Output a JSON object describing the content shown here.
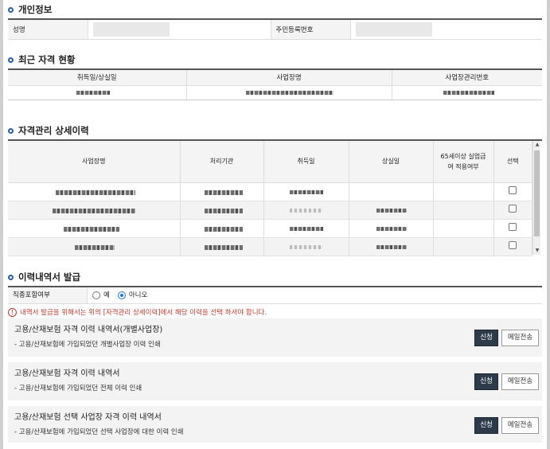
{
  "personal": {
    "title": "개인정보",
    "name_label": "성명",
    "rrn_label": "주민등록번호"
  },
  "current": {
    "title": "최근 자격 현황",
    "headers": [
      "취득일/상실일",
      "사업장명",
      "사업장관리번호"
    ]
  },
  "detail": {
    "title": "자격관리 상세이력",
    "headers": [
      "사업장명",
      "처리기관",
      "취득일",
      "상실일",
      "65세이상 실업급여 적용여부",
      "선택"
    ],
    "rows": [
      {
        "selected": false
      },
      {
        "selected": false
      },
      {
        "selected": false
      },
      {
        "selected": false
      }
    ]
  },
  "issue": {
    "title": "이력내역서 발급",
    "include_label": "직종포함여부",
    "option_yes": "예",
    "option_no": "아니오",
    "selected_option": "아니오",
    "notice": "내역서 발급을 위해서는 위의 [자격관리 상세이력]에서 해당 이력을 선택 하셔야 합니다.",
    "notice_icon": "exclamation-circle-icon",
    "docs": [
      {
        "title": "고용/산재보험 자격 이력 내역서(개별사업장)",
        "desc": "- 고용/산재보험에 가입되었던 개별사업장 이력 인쇄",
        "apply": "신청",
        "mail": "메일전송"
      },
      {
        "title": "고용/산재보험 자격 이력 내역서",
        "desc": "- 고용/산재보험에 가입되었던 전체 이력 인쇄",
        "apply": "신청",
        "mail": "메일전송"
      },
      {
        "title": "고용/산재보험 선택 사업장 자격 이력 내역서",
        "desc": "- 고용/산재보험에 가입되었던 선택 사업장에 대한 이력 인쇄",
        "apply": "신청",
        "mail": "메일전송"
      }
    ]
  },
  "colors": {
    "accent": "#2a5e9c",
    "button_dark": "#2d3a4a",
    "notice_red": "#c0392b"
  }
}
